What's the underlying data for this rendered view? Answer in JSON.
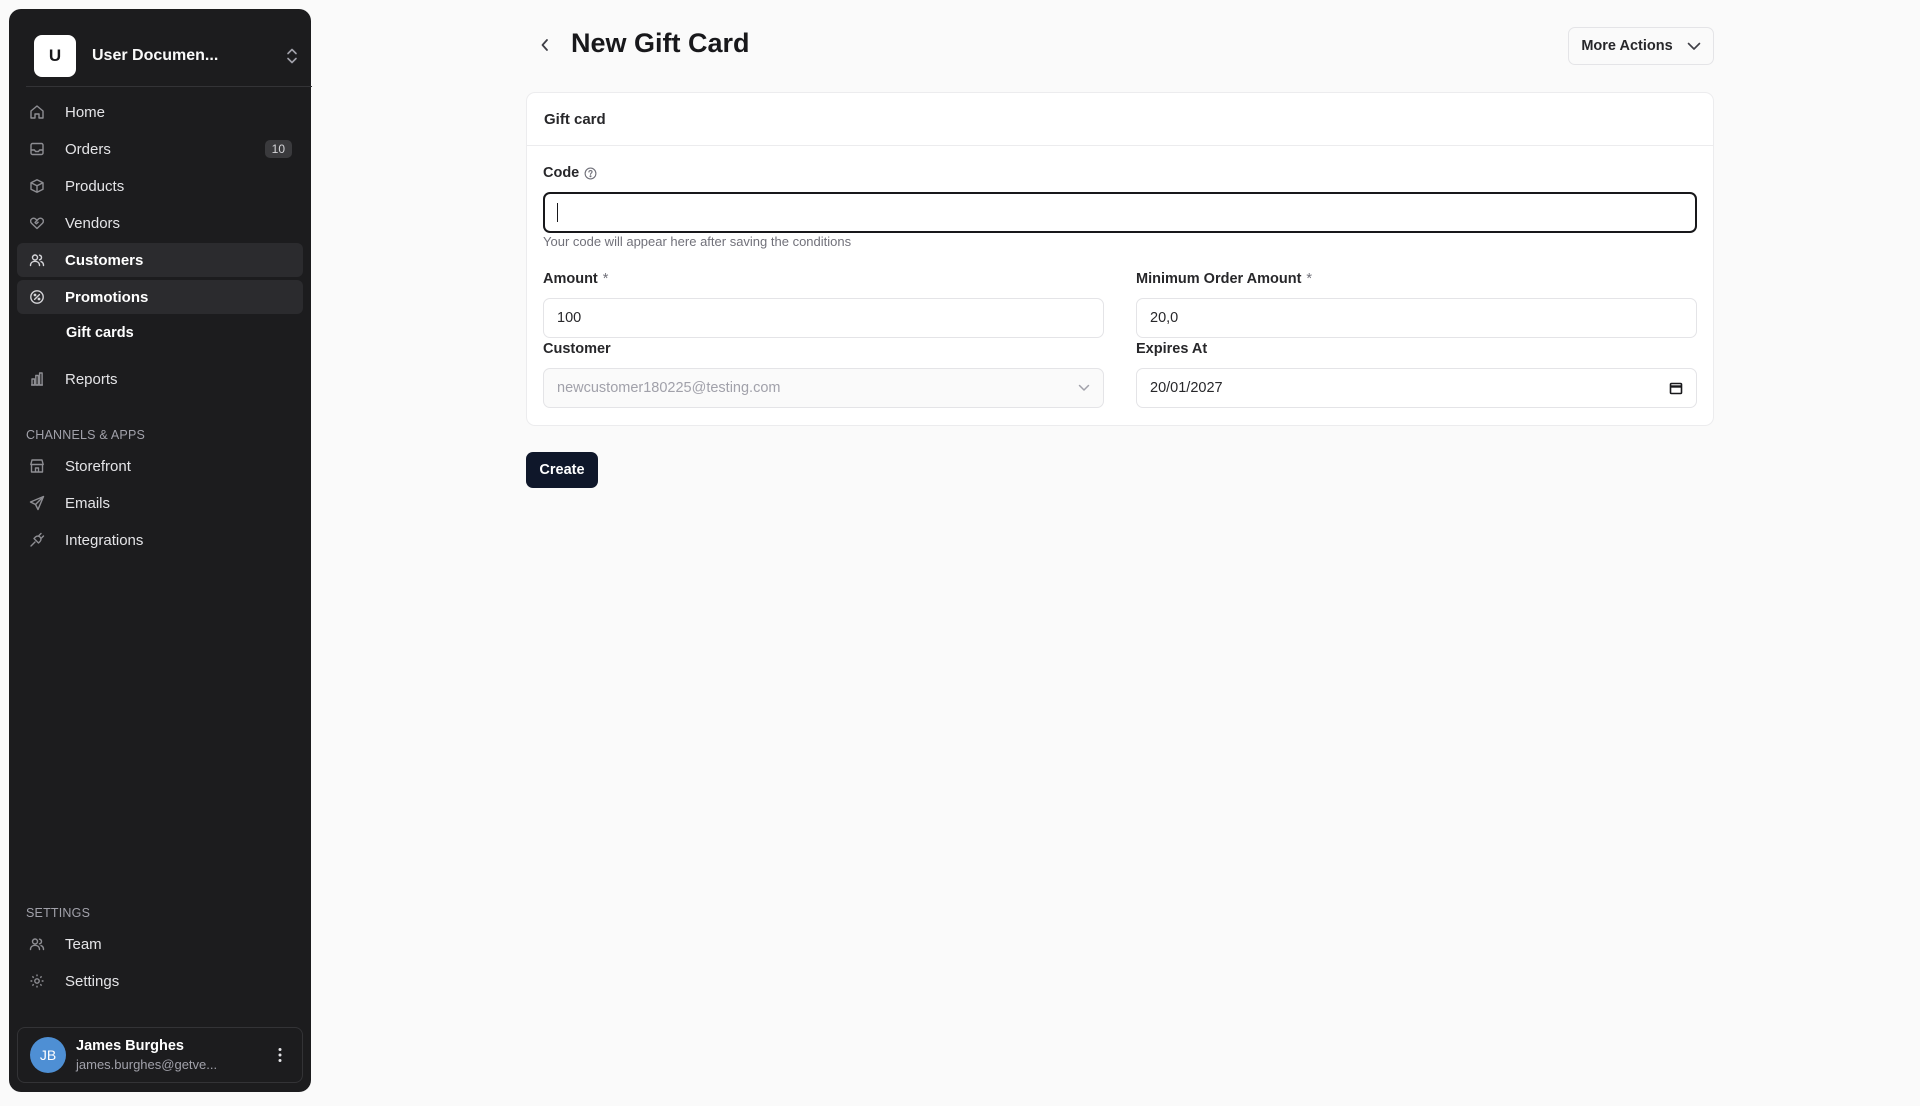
{
  "workspace": {
    "logo_letter": "U",
    "name": "User Documen..."
  },
  "nav": {
    "home": "Home",
    "orders": "Orders",
    "orders_count": "10",
    "products": "Products",
    "vendors": "Vendors",
    "customers": "Customers",
    "promotions": "Promotions",
    "gift_cards": "Gift cards",
    "reports": "Reports"
  },
  "channels": {
    "title": "CHANNELS & APPS",
    "storefront": "Storefront",
    "emails": "Emails",
    "integrations": "Integrations"
  },
  "settings_section": {
    "title": "SETTINGS",
    "team": "Team",
    "settings": "Settings"
  },
  "user": {
    "initials": "JB",
    "name": "James Burghes",
    "email": "james.burghes@getve..."
  },
  "header": {
    "title": "New Gift Card",
    "more_actions": "More Actions"
  },
  "card": {
    "title": "Gift card",
    "code_label": "Code",
    "code_value": "",
    "code_help": "Your code will appear here after saving the conditions",
    "amount_label": "Amount",
    "amount_value": "100",
    "min_order_label": "Minimum Order Amount",
    "min_order_value": "20,0",
    "required_mark": "*",
    "customer_label": "Customer",
    "customer_value": "newcustomer180225@testing.com",
    "expires_label": "Expires At",
    "expires_value": "20/01/2027"
  },
  "actions": {
    "create": "Create"
  },
  "colors": {
    "sidebar_bg": "#1c1c1e",
    "primary_button": "#0f172a",
    "avatar": "#4e8fd4"
  }
}
